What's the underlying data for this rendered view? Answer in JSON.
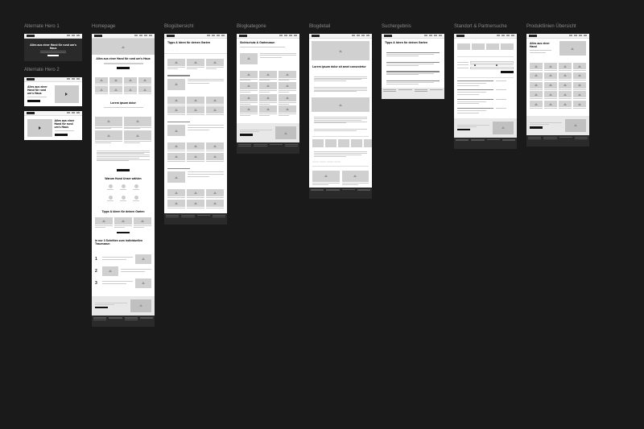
{
  "columns": [
    {
      "label": "Alternate Hero 1"
    },
    {
      "label": "Homepage"
    },
    {
      "label": "Blogübersicht"
    },
    {
      "label": "Blogkategorie"
    },
    {
      "label": "Blogdetail"
    },
    {
      "label": "Suchergebnis"
    },
    {
      "label": "Standort & Partnersuche"
    },
    {
      "label": "Produktlinien Übersicht"
    }
  ],
  "hero": {
    "title": "Alles aus einer Hand für rund um's Haus",
    "alt2_label": "Alternate Hero 2"
  },
  "homepage": {
    "s1": "Alles aus einer Hand für rund um's Haus",
    "s2": "Lorem ipsum dolor",
    "s3": "Warum Hund Unser wählen",
    "s4": "Tipps & Ideen für deinen Garten",
    "s5": "In nur 3 Schritten zum individuellen Traumzaun"
  },
  "blog": {
    "overview_title": "Tipps & Ideen für deinen Garten",
    "cat_title": "Sichtschutz & Gartenzaun",
    "detail_title": "Lorem ipsum dolor sit amet consectetur"
  },
  "search": {
    "title": "Tipps & Ideen für deinen Garten"
  },
  "partner": {
    "title": "Standort & Partnersuche"
  },
  "products": {
    "title": "Alles aus einer Hand"
  }
}
